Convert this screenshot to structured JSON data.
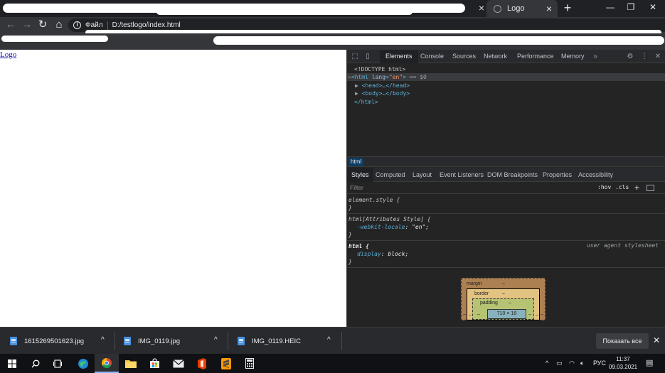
{
  "browser": {
    "active_tab_title": "Logo",
    "tab_close_glyph": "×",
    "new_tab_glyph": "+",
    "window_controls": {
      "minimize": "—",
      "restore": "❐",
      "close": "✕"
    },
    "nav": {
      "back": "←",
      "forward": "→",
      "reload": "↻",
      "home": "⌂"
    },
    "omnibox": {
      "scheme_label": "Файл",
      "url": "D:/testlogo/index.html"
    }
  },
  "page": {
    "link_text": "Logo"
  },
  "devtools": {
    "tabs": [
      "Elements",
      "Console",
      "Sources",
      "Network",
      "Performance",
      "Memory"
    ],
    "overflow_glyph": "»",
    "dom": {
      "doctype": "<!DOCTYPE html>",
      "html_open_tag": "<html",
      "html_attr_name": "lang",
      "html_attr_value": "\"en\"",
      "html_close_bracket": ">",
      "html_selected_suffix": "== $0",
      "head_line": "<head>…</head>",
      "body_line": "<body>…</body>",
      "html_close": "</html>"
    },
    "breadcrumb": "html",
    "styles_tabs": [
      "Styles",
      "Computed",
      "Layout",
      "Event Listeners",
      "DOM Breakpoints",
      "Properties",
      "Accessibility"
    ],
    "filter_placeholder": "Filter",
    "hov_label": ":hov",
    "cls_label": ".cls",
    "rules": {
      "element_style_selector": "element.style {",
      "close_brace": "}",
      "attr_style_selector": "html[Attributes Style] {",
      "locale_prop": "-webkit-locale",
      "locale_value": "\"en\";",
      "html_selector": "html {",
      "display_prop": "display",
      "display_value": "block;",
      "user_agent_label": "user agent stylesheet"
    },
    "box_model": {
      "margin_label": "margin",
      "border_label": "border",
      "padding_label": "padding",
      "dash": "–",
      "content_size": "710 × 18"
    }
  },
  "downloads": {
    "items": [
      {
        "name": "1615269501623.jpg"
      },
      {
        "name": "IMG_0119.jpg"
      },
      {
        "name": "IMG_0119.HEIC"
      }
    ],
    "chevron": "^",
    "show_all_label": "Показать все",
    "close_glyph": "✕"
  },
  "taskbar": {
    "icons": [
      "windows-start-icon",
      "search-icon",
      "task-view-icon",
      "edge-icon",
      "chrome-icon",
      "file-explorer-icon",
      "store-icon",
      "mail-icon",
      "office-icon",
      "sublime-text-icon",
      "calculator-icon"
    ],
    "tray_chevron": "^",
    "lang": "РУС",
    "time": "11:37",
    "date": "09.03.2021"
  },
  "colors": {
    "chrome_dark": "#202124",
    "toolbar": "#35363a",
    "link": "#1a0dab",
    "devtools_bg": "#242424",
    "selected_crumb": "#0e3d63",
    "margin_box": "#ad8052",
    "border_box": "#e3c381",
    "padding_box": "#b6c373",
    "content_box": "#87b1bc"
  }
}
